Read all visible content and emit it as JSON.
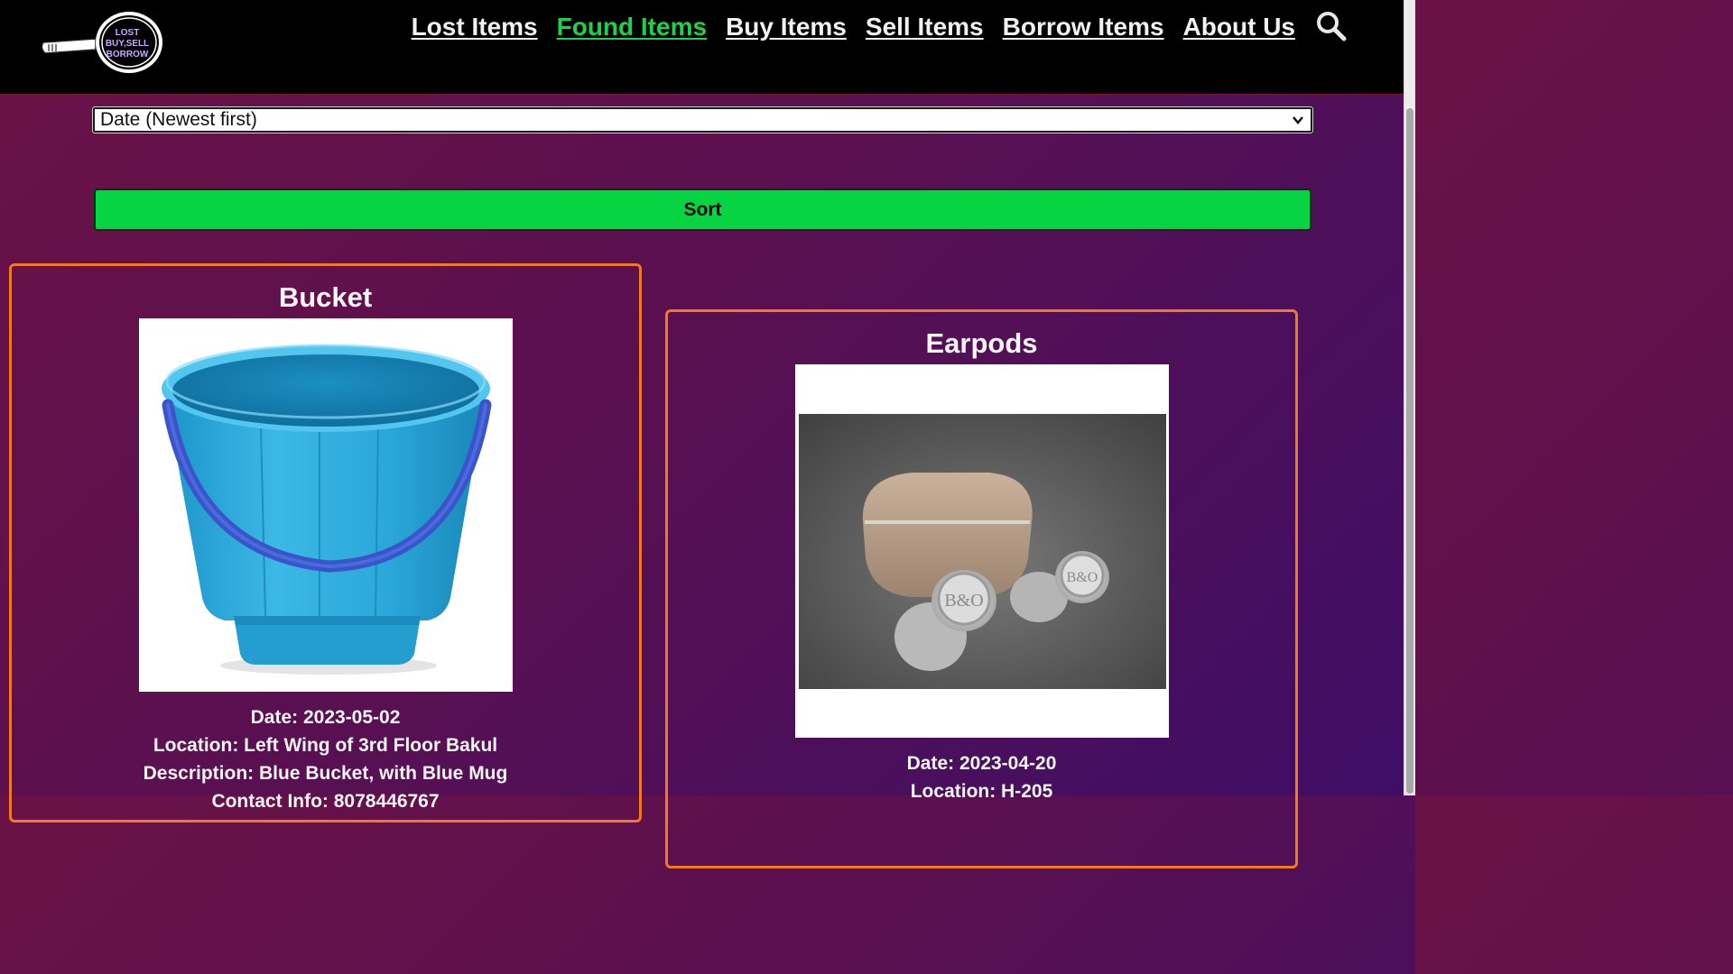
{
  "header": {
    "logo_text": [
      "LOST",
      "BUY,SELL",
      "BORROW"
    ],
    "nav": [
      {
        "label": "Lost Items",
        "active": false
      },
      {
        "label": "Found Items",
        "active": true
      },
      {
        "label": "Buy Items",
        "active": false
      },
      {
        "label": "Sell Items",
        "active": false
      },
      {
        "label": "Borrow Items",
        "active": false
      },
      {
        "label": "About Us",
        "active": false
      }
    ],
    "search_icon": "search-icon"
  },
  "sort": {
    "selected": "Date (Newest first)",
    "button_label": "Sort"
  },
  "items": [
    {
      "name": "Bucket",
      "image": "blue-bucket-photo",
      "date": "Date: 2023-05-02",
      "location": "Location: Left Wing of 3rd Floor Bakul",
      "description": "Description: Blue Bucket, with Blue Mug",
      "contact": "Contact Info: 8078446767"
    },
    {
      "name": "Earpods",
      "image": "earbuds-photo",
      "date": "Date: 2023-04-20",
      "location": "Location: H-205"
    }
  ],
  "colors": {
    "nav_active": "#1fd14a",
    "sort_button": "#06d443",
    "card_border": "#f07a21",
    "header_bg": "#000000"
  }
}
